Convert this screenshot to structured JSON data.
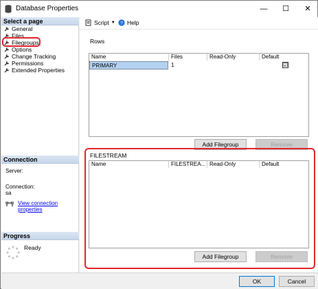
{
  "window": {
    "title": "Database Properties",
    "controls": {
      "minimize": "—",
      "maximize": "☐",
      "close": "✕"
    }
  },
  "left": {
    "select_page": "Select a page",
    "nav": [
      "General",
      "Files",
      "Filegroups",
      "Options",
      "Change Tracking",
      "Permissions",
      "Extended Properties"
    ],
    "connection": {
      "header": "Connection",
      "server_label": "Server:",
      "connection_label": "Connection:",
      "connection_value": "sa",
      "link": "View connection properties"
    },
    "progress": {
      "header": "Progress",
      "status": "Ready"
    }
  },
  "toolbar": {
    "script": "Script",
    "script_arrow": "▼",
    "help": "Help"
  },
  "rows": {
    "label": "Rows",
    "columns": [
      "Name",
      "Files",
      "Read-Only",
      "Default"
    ],
    "data": [
      {
        "name": "PRIMARY",
        "files": "1",
        "read_only": "",
        "default": "☑"
      }
    ],
    "add_button": "Add Filegroup",
    "remove_button": "Remove"
  },
  "filestream": {
    "label": "FILESTREAM",
    "columns": [
      "Name",
      "FILESTREA...",
      "Read-Only",
      "Default"
    ],
    "add_button": "Add Filegroup",
    "remove_button": "Remove"
  },
  "footer": {
    "ok": "OK",
    "cancel": "Cancel"
  },
  "colors": {
    "highlight": "#e0252e",
    "selection": "#b3d2f2",
    "section_header": "#c6d6ea"
  }
}
